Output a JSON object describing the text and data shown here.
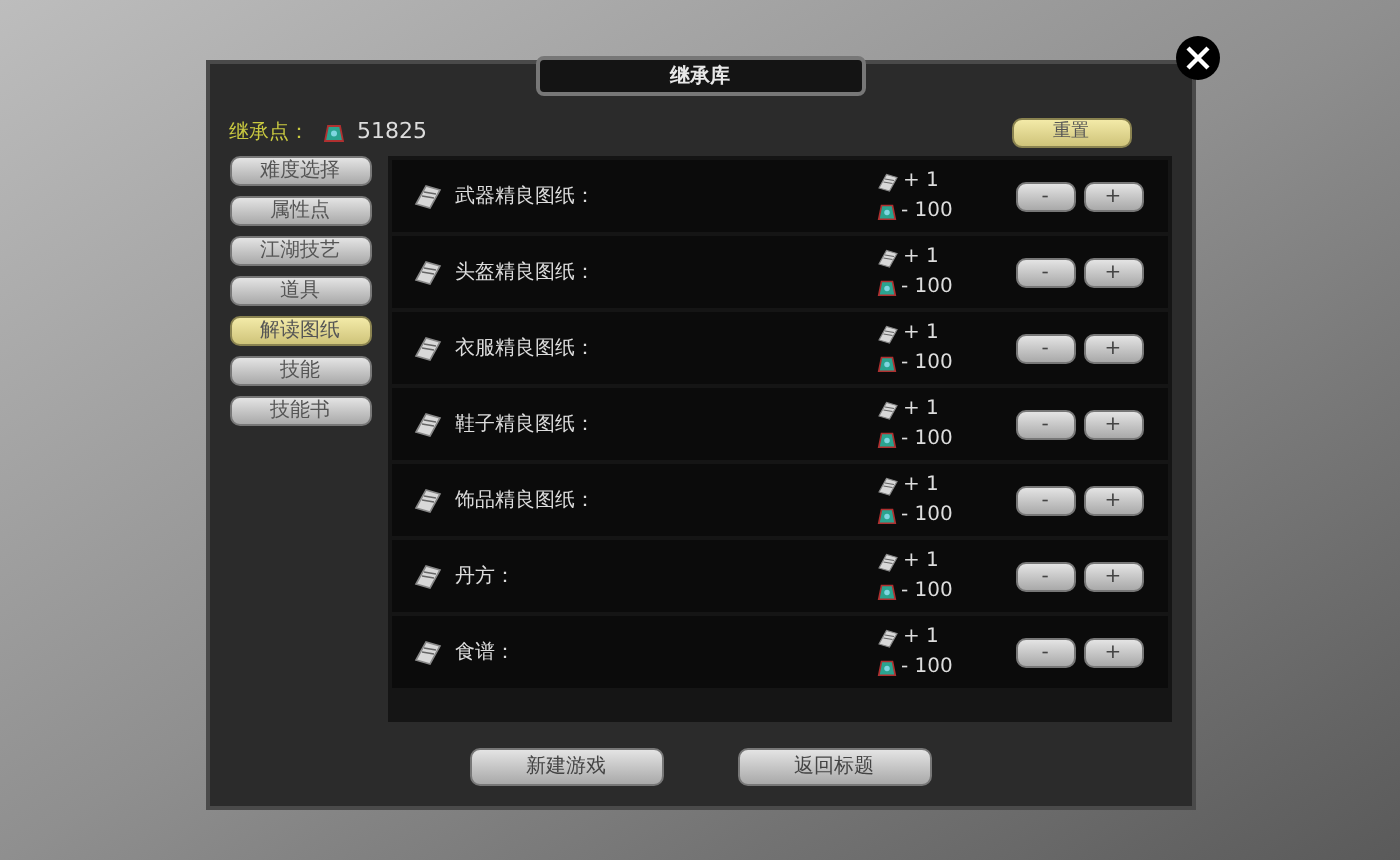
{
  "window": {
    "title": "继承库",
    "points_label": "继承点：",
    "points": "51825",
    "reset_button": "重置"
  },
  "sidebar": {
    "items": [
      {
        "label": "难度选择",
        "selected": false
      },
      {
        "label": "属性点",
        "selected": false
      },
      {
        "label": "江湖技艺",
        "selected": false
      },
      {
        "label": "道具",
        "selected": false
      },
      {
        "label": "解读图纸",
        "selected": true
      },
      {
        "label": "技能",
        "selected": false
      },
      {
        "label": "技能书",
        "selected": false
      }
    ]
  },
  "rows": [
    {
      "name": "武器精良图纸：",
      "gain": "+ 1",
      "cost": "- 100",
      "minus": "-",
      "plus": "+"
    },
    {
      "name": "头盔精良图纸：",
      "gain": "+ 1",
      "cost": "- 100",
      "minus": "-",
      "plus": "+"
    },
    {
      "name": "衣服精良图纸：",
      "gain": "+ 1",
      "cost": "- 100",
      "minus": "-",
      "plus": "+"
    },
    {
      "name": "鞋子精良图纸：",
      "gain": "+ 1",
      "cost": "- 100",
      "minus": "-",
      "plus": "+"
    },
    {
      "name": "饰品精良图纸：",
      "gain": "+ 1",
      "cost": "- 100",
      "minus": "-",
      "plus": "+"
    },
    {
      "name": "丹方：",
      "gain": "+ 1",
      "cost": "- 100",
      "minus": "-",
      "plus": "+"
    },
    {
      "name": "食谱：",
      "gain": "+ 1",
      "cost": "- 100",
      "minus": "-",
      "plus": "+"
    }
  ],
  "footer_buttons": [
    "新建游戏",
    "返回标题"
  ]
}
